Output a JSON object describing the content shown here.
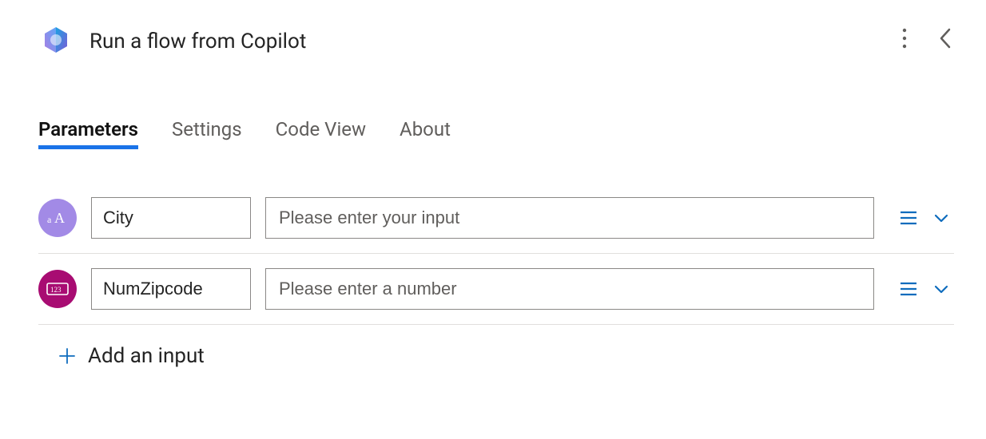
{
  "header": {
    "title": "Run a flow from Copilot"
  },
  "tabs": [
    {
      "label": "Parameters",
      "active": true
    },
    {
      "label": "Settings",
      "active": false
    },
    {
      "label": "Code View",
      "active": false
    },
    {
      "label": "About",
      "active": false
    }
  ],
  "inputs": [
    {
      "type": "text",
      "type_icon": "text-type-icon",
      "name": "City",
      "placeholder": "Please enter your input",
      "value": ""
    },
    {
      "type": "number",
      "type_icon": "number-type-icon",
      "name": "NumZipcode",
      "placeholder": "Please enter a number",
      "value": ""
    }
  ],
  "add_input": {
    "label": "Add an input"
  },
  "colors": {
    "accent": "#0078d4",
    "tab_active": "#1a73e8",
    "text_type_badge": "#a28ae6",
    "number_type_badge": "#a80c72"
  }
}
